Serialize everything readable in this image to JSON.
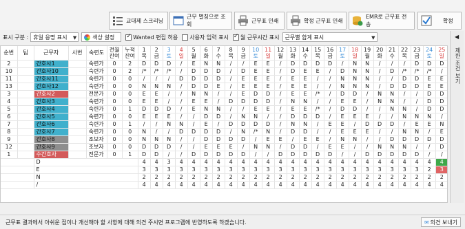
{
  "toolbar": {
    "buttons": [
      {
        "label": "교대제 스크리닝",
        "icon": "list-icon"
      },
      {
        "label": "근무 별칭으로 조회",
        "icon": "window-icon"
      },
      {
        "label": "근무표 인쇄",
        "icon": "printer-icon"
      },
      {
        "label": "확정 근무표 인쇄",
        "icon": "printer-icon"
      },
      {
        "label": "EMR로 근무표 전송",
        "icon": "db-sync-icon"
      },
      {
        "label": "확정",
        "icon": "check-icon"
      }
    ]
  },
  "options": {
    "display_label": "표시 구분 :",
    "display_value": "휴일 응명 표시",
    "color_settings": "색상 설정",
    "wanted_edit": "Wanted 편집 허용",
    "user_input": "사용자 입력 표시",
    "monthly_hours": "월 근무시간 표시",
    "summary_select": "근무별 합계 표시",
    "wanted_checked": true,
    "user_input_checked": false,
    "monthly_hours_checked": true
  },
  "sidebar": {
    "label": "제한 조건 보기"
  },
  "grid": {
    "headers": {
      "seq": "순번",
      "team": "팀",
      "worker": "근무자",
      "employee_no": "사번",
      "grade": "숙련도",
      "prev_month": "전월\n잔여",
      "cumulative": "누적\n잔여"
    },
    "days": [
      {
        "d": "1",
        "w": "목"
      },
      {
        "d": "2",
        "w": "금"
      },
      {
        "d": "3",
        "w": "토"
      },
      {
        "d": "4",
        "w": "일"
      },
      {
        "d": "5",
        "w": "월"
      },
      {
        "d": "6",
        "w": "화"
      },
      {
        "d": "7",
        "w": "수"
      },
      {
        "d": "8",
        "w": "목"
      },
      {
        "d": "9",
        "w": "금"
      },
      {
        "d": "10",
        "w": "토"
      },
      {
        "d": "11",
        "w": "일"
      },
      {
        "d": "12",
        "w": "월"
      },
      {
        "d": "13",
        "w": "화"
      },
      {
        "d": "14",
        "w": "수"
      },
      {
        "d": "15",
        "w": "목"
      },
      {
        "d": "16",
        "w": "금"
      },
      {
        "d": "17",
        "w": "토"
      },
      {
        "d": "18",
        "w": "일"
      },
      {
        "d": "19",
        "w": "월"
      },
      {
        "d": "20",
        "w": "화"
      },
      {
        "d": "21",
        "w": "수"
      },
      {
        "d": "22",
        "w": "목"
      },
      {
        "d": "23",
        "w": "금"
      },
      {
        "d": "24",
        "w": "토"
      },
      {
        "d": "25",
        "w": "일"
      }
    ],
    "rows": [
      {
        "seq": "2",
        "name": "간호사1",
        "color": "blue",
        "grade": "숙련가",
        "prev": "0",
        "cum": "2",
        "shifts": [
          "D",
          "D",
          "D",
          "/",
          "E",
          "N",
          "N",
          "/",
          "/",
          "E",
          "E",
          "/",
          "D",
          "D",
          "D",
          "D",
          "/",
          "N",
          "N",
          "/",
          "/",
          "/",
          "D",
          "D",
          "D"
        ]
      },
      {
        "seq": "10",
        "name": "간호사10",
        "color": "blue",
        "grade": "숙련가",
        "prev": "0",
        "cum": "2",
        "shifts": [
          "/*",
          "/*",
          "/*",
          "/",
          "D",
          "D",
          "D",
          "/",
          "D",
          "E",
          "E",
          "/",
          "D",
          "E",
          "E",
          "/",
          "D",
          "N",
          "N",
          "/",
          "D",
          "/*",
          "/*",
          "/*",
          "/"
        ]
      },
      {
        "seq": "11",
        "name": "간호사11",
        "color": "blue",
        "grade": "숙련가",
        "prev": "0",
        "cum": "0",
        "shifts": [
          "/",
          "/",
          "/",
          "D",
          "D",
          "D",
          "D",
          "/",
          "E",
          "E",
          "E",
          "/",
          "E",
          "E",
          "/",
          "/",
          "N",
          "N",
          "N",
          "/",
          "/",
          "D",
          "D",
          "E",
          "E"
        ]
      },
      {
        "seq": "13",
        "name": "간호사12",
        "color": "blue",
        "grade": "숙련가",
        "prev": "0",
        "cum": "0",
        "shifts": [
          "N",
          "N",
          "N",
          "/",
          "D",
          "D",
          "E",
          "/",
          "E",
          "E",
          "E",
          "/",
          "E",
          "E",
          "/",
          "/",
          "N",
          "N",
          "N",
          "/",
          "D",
          "D",
          "D",
          "E",
          "E"
        ]
      },
      {
        "seq": "3",
        "name": "간호사2",
        "color": "red",
        "grade": "전문가",
        "prev": "0",
        "cum": "0",
        "shifts": [
          "E",
          "E",
          "/",
          "/",
          "N",
          "N",
          "/",
          "/",
          "E",
          "D",
          "D",
          "/",
          "E",
          "E",
          "/*",
          "/",
          "D",
          "D",
          "/",
          "N",
          "N",
          "/",
          "/",
          "D",
          "D"
        ]
      },
      {
        "seq": "4",
        "name": "간호사3",
        "color": "blue",
        "grade": "숙련가",
        "prev": "0",
        "cum": "0",
        "shifts": [
          "E",
          "E",
          "/",
          "/",
          "E",
          "E",
          "/",
          "D",
          "D",
          "D",
          "D",
          "/",
          "N",
          "N",
          "/",
          "/",
          "E",
          "E",
          "/",
          "N",
          "N",
          "/",
          "/",
          "D",
          "D"
        ]
      },
      {
        "seq": "5",
        "name": "간호사4",
        "color": "blue",
        "grade": "숙련가",
        "prev": "0",
        "cum": "1",
        "shifts": [
          "D",
          "D",
          "D",
          "/",
          "E",
          "N",
          "N",
          "/",
          "/",
          "E",
          "E",
          "/",
          "E",
          "E",
          "/*",
          "/",
          "D",
          "D",
          "/",
          "/",
          "N",
          "N",
          "/",
          "D",
          "D"
        ]
      },
      {
        "seq": "6",
        "name": "간호사5",
        "color": "blue",
        "grade": "숙련가",
        "prev": "0",
        "cum": "0",
        "shifts": [
          "E",
          "E",
          "E",
          "/",
          "/",
          "D",
          "D",
          "/",
          "N",
          "N",
          "/",
          "/",
          "D",
          "D",
          "D",
          "/",
          "E",
          "E",
          "E",
          "/",
          "/",
          "N",
          "N",
          "N",
          "/"
        ]
      },
      {
        "seq": "7",
        "name": "간호사6",
        "color": "blue",
        "grade": "숙련가",
        "prev": "0",
        "cum": "1",
        "shifts": [
          "/",
          "/",
          "N",
          "N",
          "/",
          "E",
          "/",
          "D",
          "D",
          "D",
          "D",
          "/",
          "N",
          "N",
          "/",
          "E",
          "E",
          "/",
          "D",
          "D",
          "D",
          "/",
          "E",
          "E",
          "N"
        ]
      },
      {
        "seq": "8",
        "name": "간호사7",
        "color": "blue",
        "grade": "숙련가",
        "prev": "0",
        "cum": "0",
        "shifts": [
          "N",
          "/",
          "/",
          "D",
          "D",
          "D",
          "D",
          "/",
          "N",
          "/*",
          "N",
          "/",
          "D",
          "D",
          "/",
          "/",
          "E",
          "E",
          "E",
          "/",
          "/",
          "N",
          "N",
          "/",
          "E"
        ]
      },
      {
        "seq": "9",
        "name": "간호사8",
        "color": "gray",
        "grade": "조보자",
        "prev": "0",
        "cum": "0",
        "shifts": [
          "N",
          "N",
          "N",
          "/",
          "/",
          "D",
          "D",
          "D",
          "D",
          "/",
          "E",
          "E",
          "/",
          "E",
          "E",
          "/",
          "N",
          "N",
          "/",
          "/",
          "D",
          "D",
          "D",
          "D",
          "D"
        ]
      },
      {
        "seq": "12",
        "name": "간호사9",
        "color": "gray",
        "grade": "조보자",
        "prev": "0",
        "cum": "0",
        "shifts": [
          "D",
          "D",
          "D",
          "/",
          "/",
          "E",
          "E",
          "E",
          "/",
          "N",
          "N",
          "/",
          "D",
          "D",
          "/",
          "E",
          "E",
          "/",
          "/",
          "N",
          "N",
          "N",
          "/",
          "/",
          "D"
        ]
      },
      {
        "seq": "1",
        "name": "수간호사",
        "color": "red",
        "grade": "전문가",
        "prev": "0",
        "cum": "1",
        "shifts": [
          "D",
          "D",
          "/",
          "/",
          "D",
          "D",
          "D",
          "D",
          "D",
          "/",
          "/",
          "D",
          "D",
          "D",
          "D",
          "D",
          "/",
          "/",
          "D",
          "D",
          "D",
          "D",
          "D",
          "/",
          "/"
        ]
      }
    ],
    "summary": [
      {
        "label": "D",
        "values": [
          "4",
          "4",
          "3",
          "4",
          "4",
          "4",
          "4",
          "4",
          "4",
          "4",
          "4",
          "4",
          "4",
          "4",
          "4",
          "4",
          "4",
          "4",
          "4",
          "4",
          "4",
          "4",
          "4",
          "4",
          "4"
        ]
      },
      {
        "label": "E",
        "values": [
          "3",
          "3",
          "3",
          "3",
          "3",
          "3",
          "3",
          "3",
          "3",
          "3",
          "3",
          "3",
          "3",
          "3",
          "3",
          "3",
          "3",
          "3",
          "3",
          "3",
          "3",
          "3",
          "3",
          "2",
          "3"
        ]
      },
      {
        "label": "N",
        "values": [
          "2",
          "2",
          "2",
          "2",
          "2",
          "2",
          "2",
          "2",
          "2",
          "2",
          "2",
          "2",
          "2",
          "2",
          "2",
          "2",
          "2",
          "2",
          "2",
          "2",
          "2",
          "2",
          "2",
          "2",
          "2"
        ]
      },
      {
        "label": "/",
        "values": [
          "4",
          "4",
          "4",
          "4",
          "4",
          "4",
          "4",
          "4",
          "4",
          "4",
          "4",
          "4",
          "4",
          "4",
          "4",
          "4",
          "4",
          "4",
          "4",
          "4",
          "4",
          "4",
          "4",
          "4",
          "4"
        ]
      }
    ]
  },
  "status": {
    "message": "근무표 결과에서 아쉬운 점이나 개선해야 할 사항에 대해 의견 주시면 프로그램에 반영하도록 하겠습니다.",
    "feedback_button": "의견 보내기"
  },
  "colors": {
    "blue_name": "#40b0cc",
    "red_name": "#d35a5a",
    "gray_name": "#8e8e8e",
    "highlight_green": "#3fa84a",
    "highlight_red": "#e06363"
  }
}
